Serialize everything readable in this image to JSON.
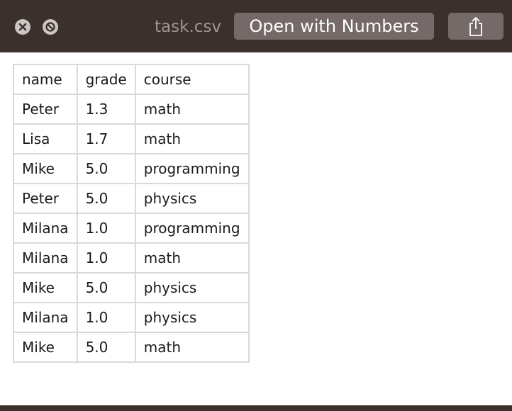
{
  "window": {
    "file_name": "task.csv",
    "open_button_label": "Open with Numbers",
    "icons": {
      "close": "close-icon",
      "minimize": "minimize-icon",
      "share": "share-icon"
    },
    "colors": {
      "titlebar": "#3c302c",
      "button": "#756a67",
      "grid": "#d9d9d9"
    }
  },
  "table": {
    "rows": [
      [
        "name",
        "grade",
        "course"
      ],
      [
        "Peter",
        "1.3",
        "math"
      ],
      [
        "Lisa",
        "1.7",
        "math"
      ],
      [
        "Mike",
        "5.0",
        "programming"
      ],
      [
        "Peter",
        "5.0",
        "physics"
      ],
      [
        "Milana",
        "1.0",
        "programming"
      ],
      [
        "Milana",
        "1.0",
        "math"
      ],
      [
        "Mike",
        "5.0",
        "physics"
      ],
      [
        "Milana",
        "1.0",
        "physics"
      ],
      [
        "Mike",
        "5.0",
        "math"
      ]
    ]
  }
}
